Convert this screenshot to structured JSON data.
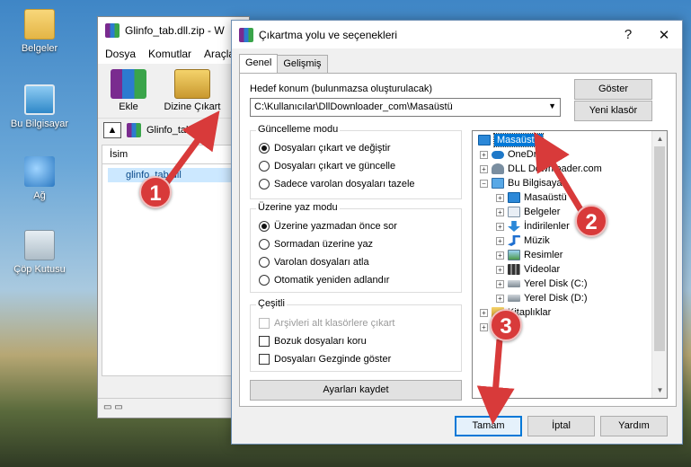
{
  "desktop": {
    "icons": [
      {
        "label": "Belgeler"
      },
      {
        "label": "Bu Bilgisayar"
      },
      {
        "label": "Ağ"
      },
      {
        "label": "Çöp Kutusu"
      }
    ]
  },
  "winrar": {
    "title": "Glinfo_tab.dll.zip - W",
    "menu": [
      "Dosya",
      "Komutlar",
      "Araçlar"
    ],
    "toolbar": {
      "add": "Ekle",
      "extract": "Dizine Çıkart"
    },
    "path": "Glinfo_tab.d",
    "column_name": "İsim",
    "file": "glinfo_tab.dll"
  },
  "dialog": {
    "title": "Çıkartma yolu ve seçenekleri",
    "tabs": [
      "Genel",
      "Gelişmiş"
    ],
    "dest_label": "Hedef konum (bulunmazsa oluşturulacak)",
    "dest_value": "C:\\Kullanıcılar\\DllDownloader_com\\Masaüstü",
    "show_button": "Göster",
    "new_folder_button": "Yeni klasör",
    "update_mode": {
      "title": "Güncelleme modu",
      "options": [
        "Dosyaları çıkart ve değiştir",
        "Dosyaları çıkart ve güncelle",
        "Sadece varolan dosyaları tazele"
      ],
      "selected": 0
    },
    "overwrite_mode": {
      "title": "Üzerine yaz modu",
      "options": [
        "Üzerine yazmadan önce sor",
        "Sormadan üzerine yaz",
        "Varolan dosyaları atla",
        "Otomatik yeniden adlandır"
      ],
      "selected": 0
    },
    "misc": {
      "title": "Çeşitli",
      "options": [
        "Arşivleri alt klasörlere çıkart",
        "Bozuk dosyaları koru",
        "Dosyaları Gezginde göster"
      ]
    },
    "save_settings_button": "Ayarları kaydet",
    "tree": [
      {
        "label": "Masaüstü",
        "selected": true
      },
      {
        "label": "OneDrive"
      },
      {
        "label": "DLL Downloader.com"
      },
      {
        "label": "Bu Bilgisayar"
      },
      {
        "label": "Masaüstü"
      },
      {
        "label": "Belgeler"
      },
      {
        "label": "İndirilenler"
      },
      {
        "label": "Müzik"
      },
      {
        "label": "Resimler"
      },
      {
        "label": "Videolar"
      },
      {
        "label": "Yerel Disk (C:)"
      },
      {
        "label": "Yerel Disk (D:)"
      },
      {
        "label": "Kitaplıklar"
      },
      {
        "label": "Ağ"
      }
    ],
    "ok_button": "Tamam",
    "cancel_button": "İptal",
    "help_button": "Yardım"
  },
  "annotations": [
    "1",
    "2",
    "3"
  ],
  "colors": {
    "selection": "#0078d7",
    "marker": "#d83a3a"
  }
}
